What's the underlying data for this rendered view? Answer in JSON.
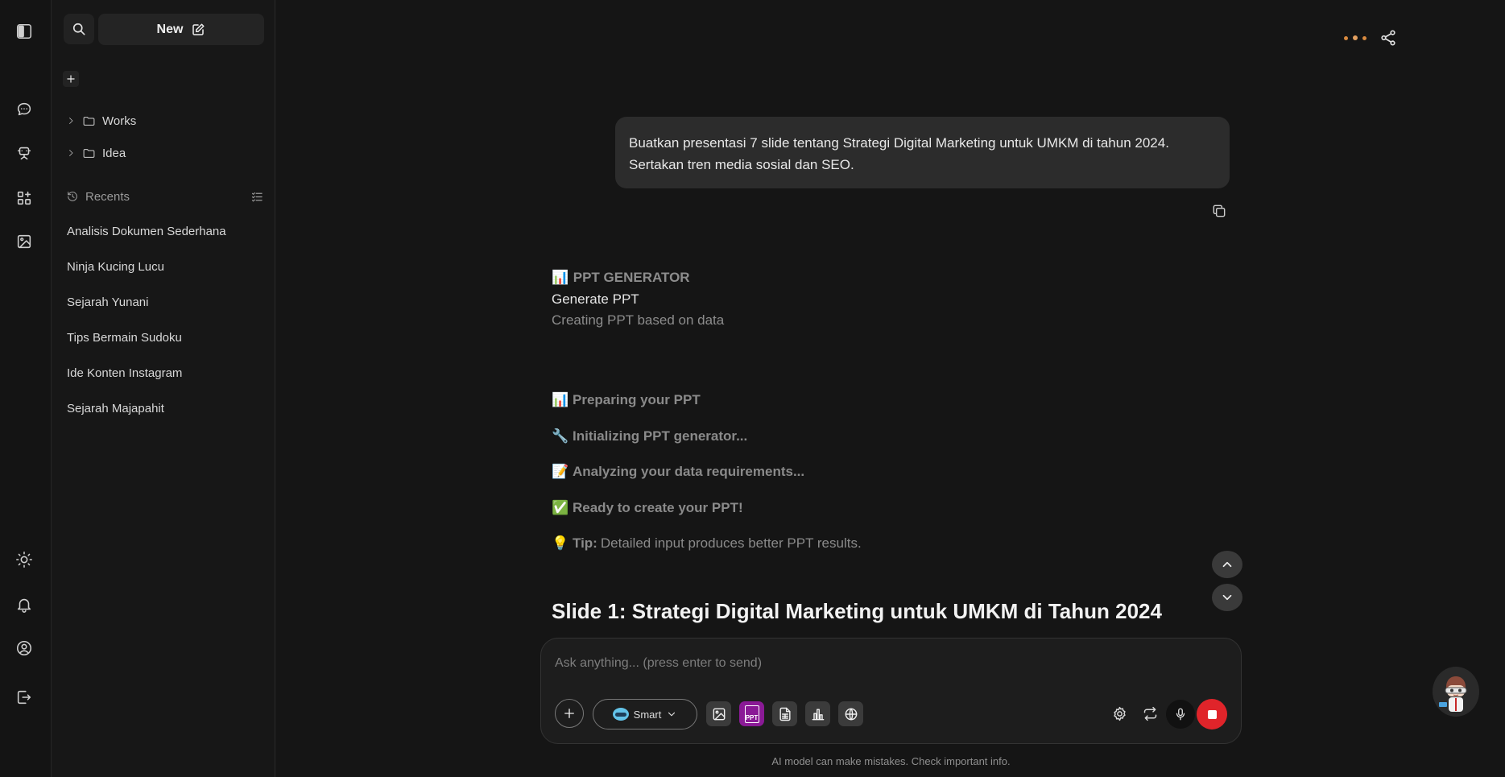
{
  "sidebar": {
    "new_label": "New",
    "folders": [
      {
        "label": "Works"
      },
      {
        "label": "Idea"
      }
    ],
    "recents_label": "Recents",
    "recents": [
      "Analisis Dokumen Sederhana",
      "Ninja Kucing Lucu",
      "Sejarah Yunani",
      "Tips Bermain Sudoku",
      "Ide Konten Instagram",
      "Sejarah Majapahit"
    ]
  },
  "chat": {
    "user_message_line1": "Buatkan presentasi 7 slide tentang Strategi Digital Marketing untuk UMKM di tahun 2024.",
    "user_message_line2": "Sertakan tren media sosial dan SEO.",
    "generator": {
      "icon": "📊",
      "title": "PPT GENERATOR",
      "subtitle": "Generate PPT",
      "description": "Creating PPT based on data"
    },
    "steps": [
      {
        "emoji": "📊",
        "text": "Preparing your PPT"
      },
      {
        "emoji": "🔧",
        "text": "Initializing PPT generator..."
      },
      {
        "emoji": "📝",
        "text": "Analyzing your data requirements..."
      },
      {
        "emoji": "✅",
        "text": "Ready to create your PPT!"
      }
    ],
    "tip": {
      "emoji": "💡",
      "label": "Tip:",
      "text": "Detailed input produces better PPT results."
    },
    "slide_heading": "Slide 1: Strategi Digital Marketing untuk UMKM di Tahun 2024"
  },
  "composer": {
    "placeholder": "Ask anything... (press enter to send)",
    "model_label": "Smart",
    "ppt_label": "PPT"
  },
  "disclaimer": "AI model can make mistakes. Check important info.",
  "colors": {
    "accent_stop": "#e0242a",
    "ppt_tool": "#8a1a96",
    "status_dots": "#d98a3f"
  }
}
